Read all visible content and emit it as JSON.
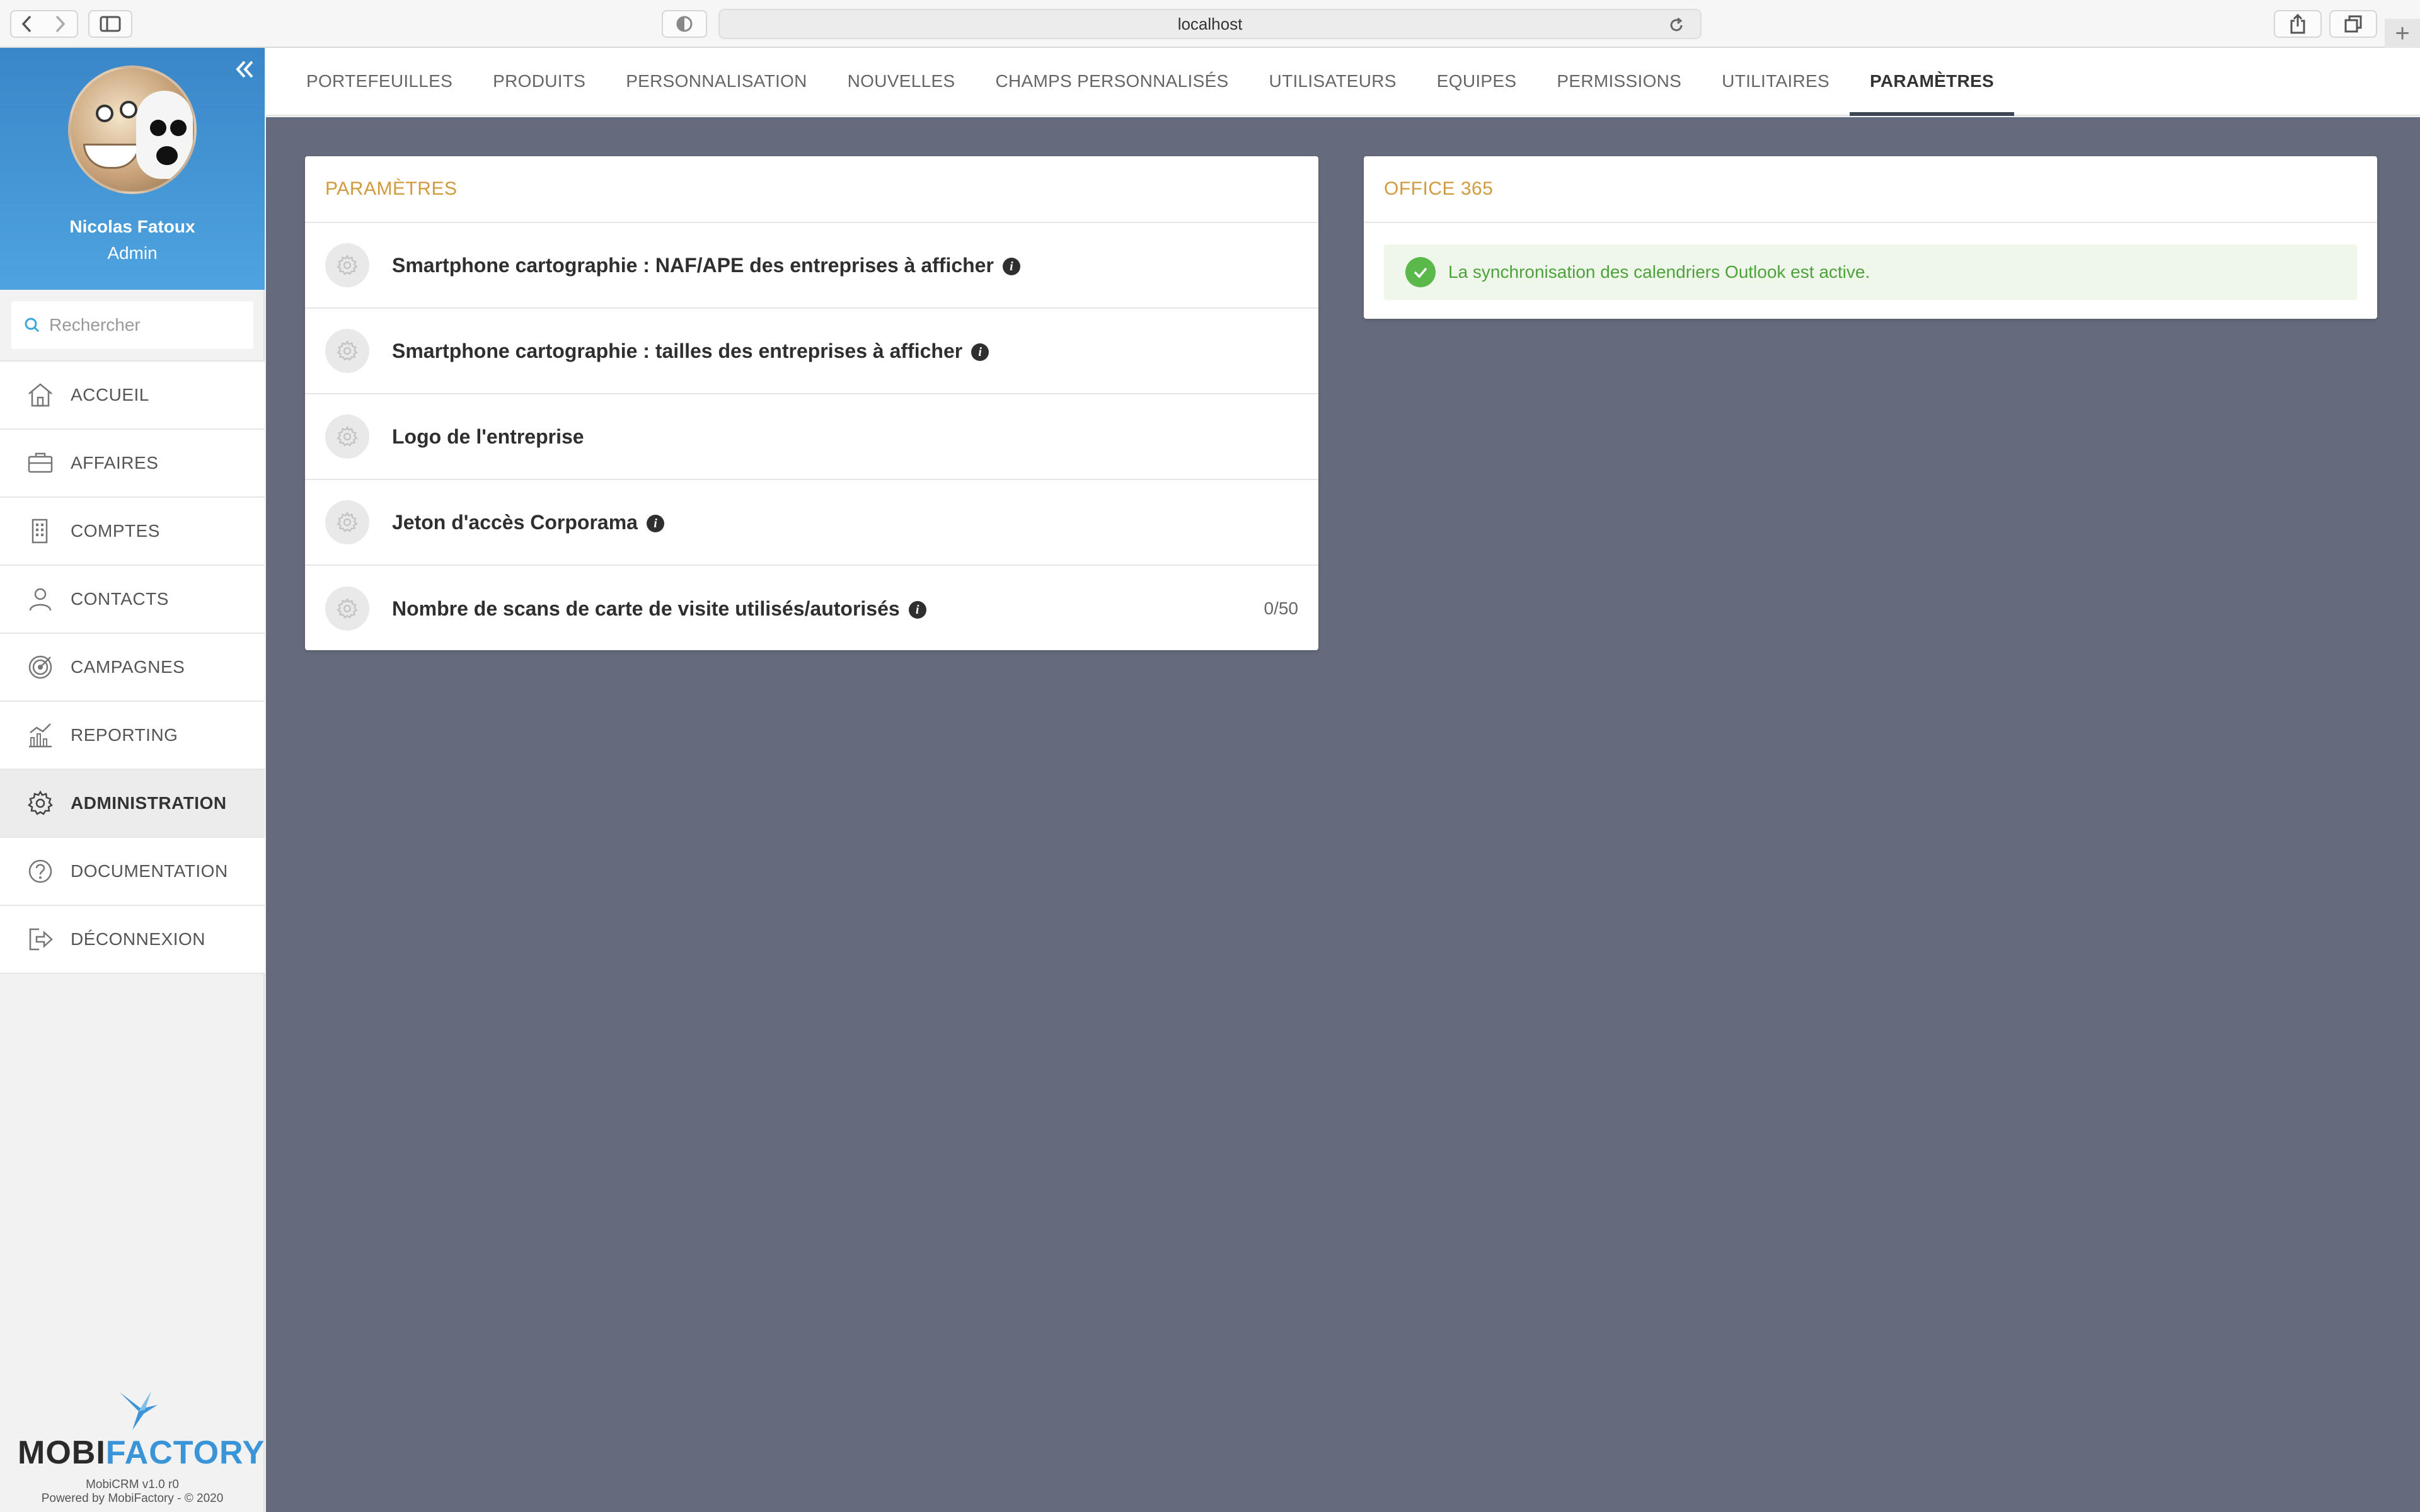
{
  "browser": {
    "url": "localhost"
  },
  "sidebar": {
    "user": {
      "name": "Nicolas Fatoux",
      "role": "Admin"
    },
    "search_placeholder": "Rechercher",
    "items": [
      {
        "label": "ACCUEIL",
        "icon": "home-icon"
      },
      {
        "label": "AFFAIRES",
        "icon": "briefcase-icon"
      },
      {
        "label": "COMPTES",
        "icon": "building-icon"
      },
      {
        "label": "CONTACTS",
        "icon": "person-icon"
      },
      {
        "label": "CAMPAGNES",
        "icon": "target-icon"
      },
      {
        "label": "REPORTING",
        "icon": "chart-icon"
      },
      {
        "label": "ADMINISTRATION",
        "icon": "gear-icon",
        "active": true
      },
      {
        "label": "DOCUMENTATION",
        "icon": "question-icon"
      },
      {
        "label": "DÉCONNEXION",
        "icon": "logout-icon"
      }
    ],
    "brand": {
      "word_a": "MOBI",
      "word_b": "FACTORY",
      "version": "MobiCRM v1.0 r0",
      "powered": "Powered by MobiFactory - © 2020"
    }
  },
  "topnav": {
    "tabs": [
      {
        "label": "PORTEFEUILLES"
      },
      {
        "label": "PRODUITS"
      },
      {
        "label": "PERSONNALISATION"
      },
      {
        "label": "NOUVELLES"
      },
      {
        "label": "CHAMPS PERSONNALISÉS"
      },
      {
        "label": "UTILISATEURS"
      },
      {
        "label": "EQUIPES"
      },
      {
        "label": "PERMISSIONS"
      },
      {
        "label": "UTILITAIRES"
      },
      {
        "label": "PARAMÈTRES",
        "active": true
      }
    ]
  },
  "params": {
    "title": "PARAMÈTRES",
    "rows": [
      {
        "label": "Smartphone cartographie : NAF/APE des entreprises à afficher",
        "info": true,
        "value": ""
      },
      {
        "label": "Smartphone cartographie : tailles des entreprises à afficher",
        "info": true,
        "value": ""
      },
      {
        "label": "Logo de l'entreprise",
        "info": false,
        "value": ""
      },
      {
        "label": "Jeton d'accès Corporama",
        "info": true,
        "value": ""
      },
      {
        "label": "Nombre de scans de carte de visite utilisés/autorisés",
        "info": true,
        "value": "0/50"
      }
    ]
  },
  "office": {
    "title": "OFFICE 365",
    "alert": "La synchronisation des calendriers Outlook est active."
  },
  "colors": {
    "accent_orange": "#d29a3e",
    "sidebar_blue": "#3a86c8",
    "main_bg": "#636b7c",
    "success_green": "#5bb84a"
  }
}
